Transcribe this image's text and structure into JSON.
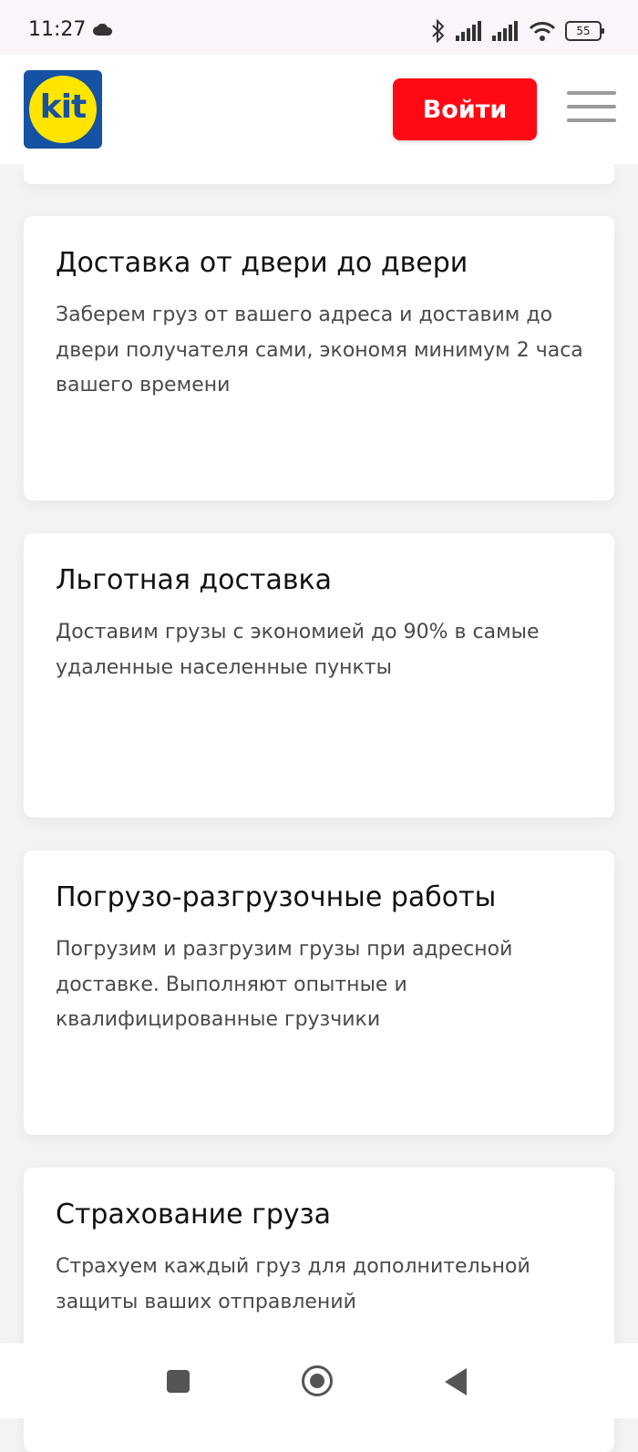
{
  "status_bar": {
    "time": "11:27",
    "battery": "55"
  },
  "header": {
    "logo_text": "kit",
    "login_label": "Войти"
  },
  "cards": [
    {
      "title": "Доставка от двери до двери",
      "text": "Заберем груз от вашего адреса и доставим до двери получателя сами, экономя минимум 2 часа вашего времени"
    },
    {
      "title": "Льготная доставка",
      "text": "Доставим грузы с экономией до 90% в самые удаленные населенные пункты"
    },
    {
      "title": "Погрузо-разгрузочные работы",
      "text": "Погрузим и разгрузим грузы при адресной доставке. Выполняют опытные и квалифицированные грузчики"
    },
    {
      "title": "Страхование груза",
      "text": "Страхуем каждый груз для дополнительной защиты ваших отправлений"
    }
  ],
  "colors": {
    "accent": "#ff0a14",
    "logo_blue": "#1552a3",
    "logo_yellow": "#ffe500"
  },
  "icons": [
    "cloud-icon",
    "bluetooth-icon",
    "signal-icon",
    "wifi-icon",
    "battery-icon",
    "menu-icon",
    "recent-apps-icon",
    "home-icon",
    "back-icon"
  ]
}
